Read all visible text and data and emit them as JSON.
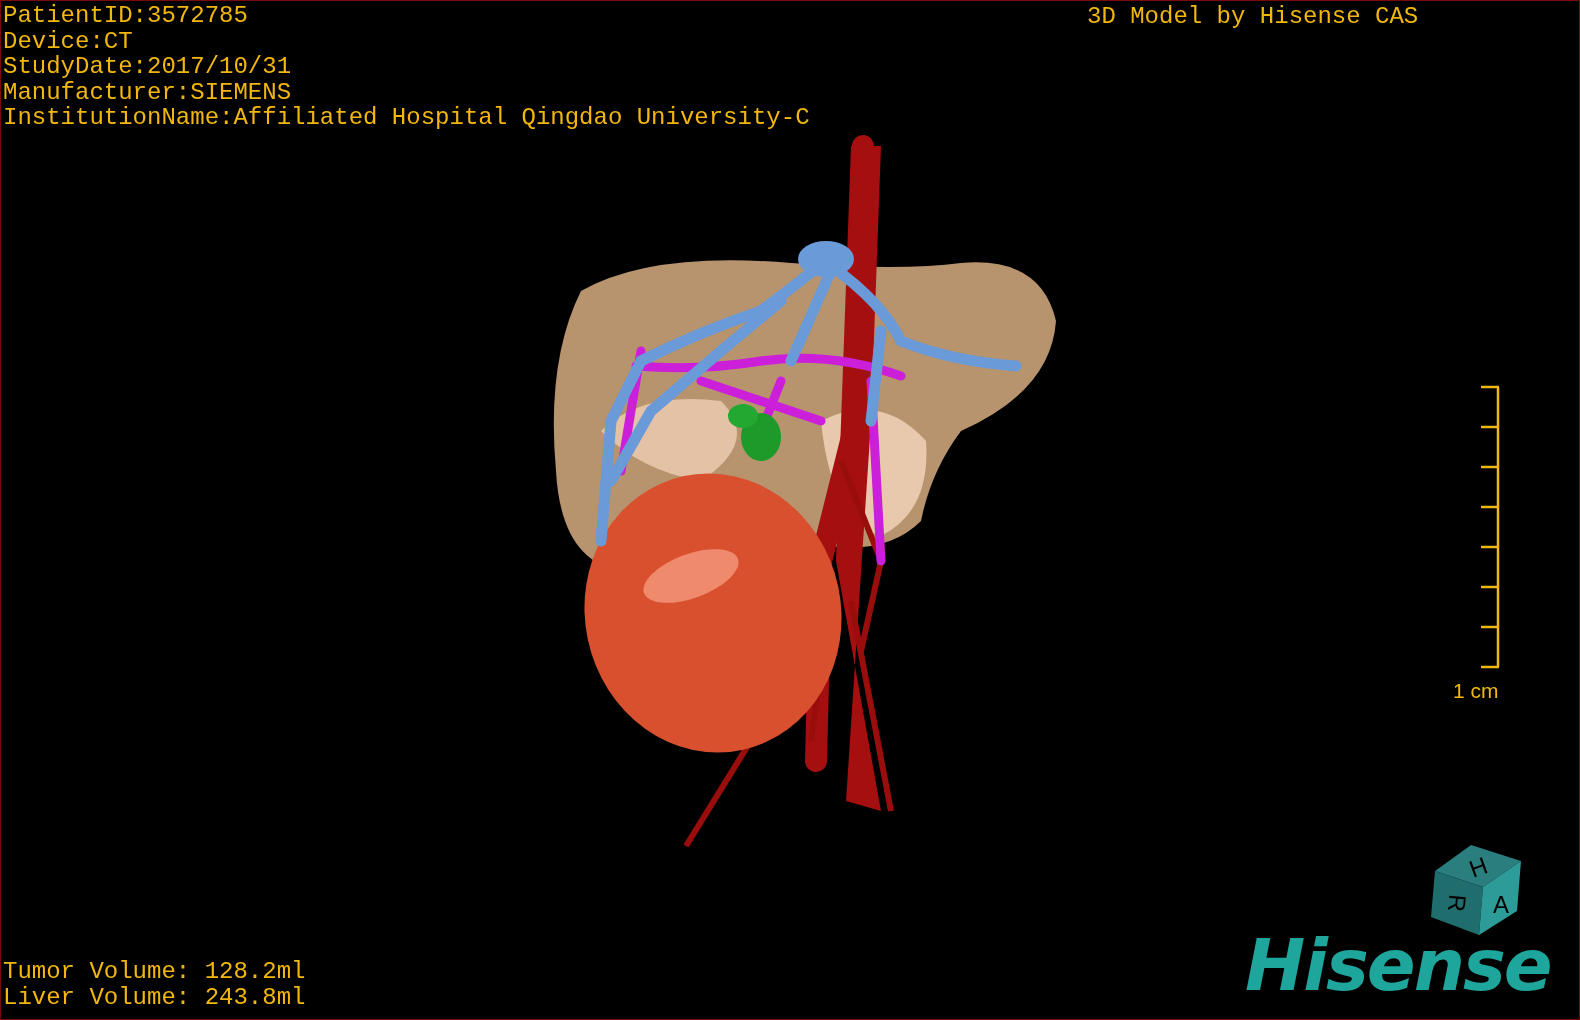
{
  "patient_info": [
    "PatientID:3572785",
    "Device:CT",
    "StudyDate:2017/10/31",
    "Manufacturer:SIEMENS",
    "InstitutionName:Affiliated Hospital Qingdao University-C"
  ],
  "title": "3D Model by Hisense CAS",
  "scale_bar": {
    "label": "1 cm"
  },
  "orientation_cube": {
    "faces": [
      "H",
      "R",
      "A"
    ]
  },
  "logo": "Hisense",
  "volumes": [
    "Tumor Volume: 128.2ml",
    "Liver Volume: 243.8ml"
  ]
}
